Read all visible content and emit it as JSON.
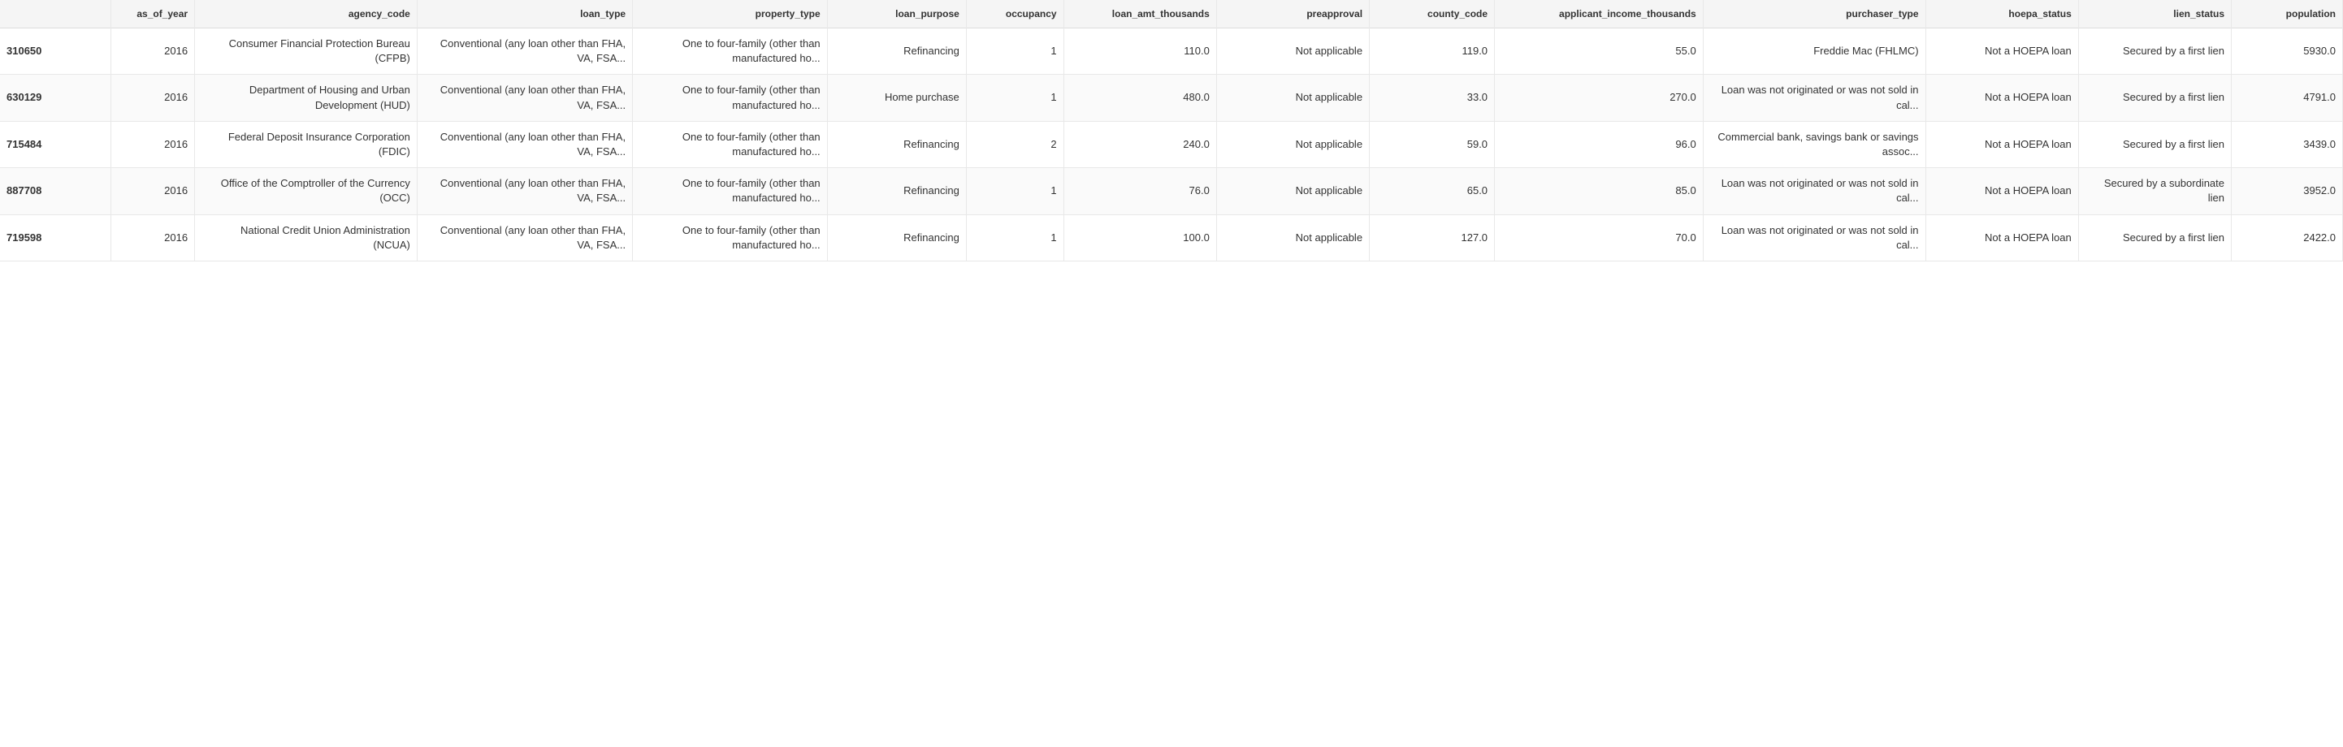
{
  "table": {
    "columns": [
      {
        "key": "id",
        "label": ""
      },
      {
        "key": "as_of_year",
        "label": "as_of_year"
      },
      {
        "key": "agency_code",
        "label": "agency_code"
      },
      {
        "key": "loan_type",
        "label": "loan_type"
      },
      {
        "key": "property_type",
        "label": "property_type"
      },
      {
        "key": "loan_purpose",
        "label": "loan_purpose"
      },
      {
        "key": "occupancy",
        "label": "occupancy"
      },
      {
        "key": "loan_amt_thousands",
        "label": "loan_amt_thousands"
      },
      {
        "key": "preapproval",
        "label": "preapproval"
      },
      {
        "key": "county_code",
        "label": "county_code"
      },
      {
        "key": "applicant_income_thousands",
        "label": "applicant_income_thousands"
      },
      {
        "key": "purchaser_type",
        "label": "purchaser_type"
      },
      {
        "key": "hoepa_status",
        "label": "hoepa_status"
      },
      {
        "key": "lien_status",
        "label": "lien_status"
      },
      {
        "key": "population",
        "label": "population"
      }
    ],
    "rows": [
      {
        "id": "310650",
        "as_of_year": "2016",
        "agency_code": "Consumer Financial Protection Bureau (CFPB)",
        "loan_type": "Conventional (any loan other than FHA, VA, FSA...",
        "property_type": "One to four-family (other than manufactured ho...",
        "loan_purpose": "Refinancing",
        "occupancy": "1",
        "loan_amt_thousands": "110.0",
        "preapproval": "Not applicable",
        "county_code": "119.0",
        "applicant_income_thousands": "55.0",
        "purchaser_type": "Freddie Mac (FHLMC)",
        "hoepa_status": "Not a HOEPA loan",
        "lien_status": "Secured by a first lien",
        "population": "5930.0"
      },
      {
        "id": "630129",
        "as_of_year": "2016",
        "agency_code": "Department of Housing and Urban Development (HUD)",
        "loan_type": "Conventional (any loan other than FHA, VA, FSA...",
        "property_type": "One to four-family (other than manufactured ho...",
        "loan_purpose": "Home purchase",
        "occupancy": "1",
        "loan_amt_thousands": "480.0",
        "preapproval": "Not applicable",
        "county_code": "33.0",
        "applicant_income_thousands": "270.0",
        "purchaser_type": "Loan was not originated or was not sold in cal...",
        "hoepa_status": "Not a HOEPA loan",
        "lien_status": "Secured by a first lien",
        "population": "4791.0"
      },
      {
        "id": "715484",
        "as_of_year": "2016",
        "agency_code": "Federal Deposit Insurance Corporation (FDIC)",
        "loan_type": "Conventional (any loan other than FHA, VA, FSA...",
        "property_type": "One to four-family (other than manufactured ho...",
        "loan_purpose": "Refinancing",
        "occupancy": "2",
        "loan_amt_thousands": "240.0",
        "preapproval": "Not applicable",
        "county_code": "59.0",
        "applicant_income_thousands": "96.0",
        "purchaser_type": "Commercial bank, savings bank or savings assoc...",
        "hoepa_status": "Not a HOEPA loan",
        "lien_status": "Secured by a first lien",
        "population": "3439.0"
      },
      {
        "id": "887708",
        "as_of_year": "2016",
        "agency_code": "Office of the Comptroller of the Currency (OCC)",
        "loan_type": "Conventional (any loan other than FHA, VA, FSA...",
        "property_type": "One to four-family (other than manufactured ho...",
        "loan_purpose": "Refinancing",
        "occupancy": "1",
        "loan_amt_thousands": "76.0",
        "preapproval": "Not applicable",
        "county_code": "65.0",
        "applicant_income_thousands": "85.0",
        "purchaser_type": "Loan was not originated or was not sold in cal...",
        "hoepa_status": "Not a HOEPA loan",
        "lien_status": "Secured by a subordinate lien",
        "population": "3952.0"
      },
      {
        "id": "719598",
        "as_of_year": "2016",
        "agency_code": "National Credit Union Administration (NCUA)",
        "loan_type": "Conventional (any loan other than FHA, VA, FSA...",
        "property_type": "One to four-family (other than manufactured ho...",
        "loan_purpose": "Refinancing",
        "occupancy": "1",
        "loan_amt_thousands": "100.0",
        "preapproval": "Not applicable",
        "county_code": "127.0",
        "applicant_income_thousands": "70.0",
        "purchaser_type": "Loan was not originated or was not sold in cal...",
        "hoepa_status": "Not a HOEPA loan",
        "lien_status": "Secured by a first lien",
        "population": "2422.0"
      }
    ]
  }
}
